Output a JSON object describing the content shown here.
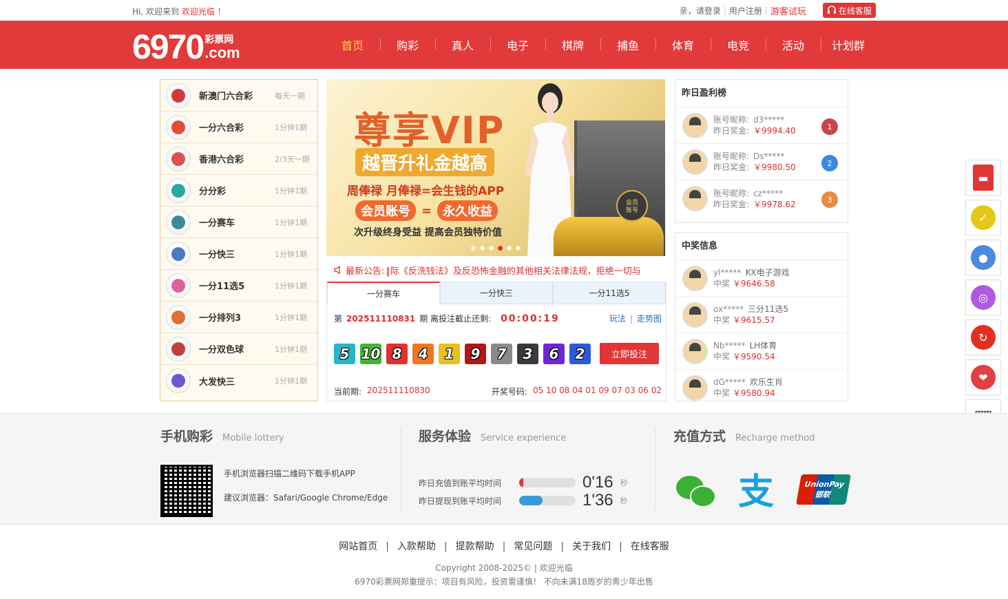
{
  "topbar": {
    "greeting": "Hi, 欢迎来到",
    "site": "欢迎光临",
    "exclaim": "！",
    "login": "亲，请登录",
    "register": "用户注册",
    "trial": "游客试玩",
    "service": "在线客服"
  },
  "logo": {
    "number": "6970",
    "cn": "彩票网",
    "com": ".com"
  },
  "nav": [
    "首页",
    "购彩",
    "真人",
    "电子",
    "棋牌",
    "捕鱼",
    "体育",
    "电竞",
    "活动",
    "计划群"
  ],
  "lotteries": [
    {
      "name": "新澳门六合彩",
      "freq": "每天一期",
      "color": "#d23a3a"
    },
    {
      "name": "一分六合彩",
      "freq": "1分钟1期",
      "color": "#e24a3a"
    },
    {
      "name": "香港六合彩",
      "freq": "2/3天一期",
      "color": "#e05050"
    },
    {
      "name": "分分彩",
      "freq": "1分钟1期",
      "color": "#2aa7a0"
    },
    {
      "name": "一分赛车",
      "freq": "1分钟1期",
      "color": "#3a8a9a"
    },
    {
      "name": "一分快三",
      "freq": "1分钟1期",
      "color": "#4a7ac0"
    },
    {
      "name": "一分11选5",
      "freq": "1分钟1期",
      "color": "#e060a0"
    },
    {
      "name": "一分排列3",
      "freq": "1分钟1期",
      "color": "#e07030"
    },
    {
      "name": "一分双色球",
      "freq": "1分钟1期",
      "color": "#c04040"
    },
    {
      "name": "大发快三",
      "freq": "1分钟1期",
      "color": "#6a5ad0"
    }
  ],
  "banner": {
    "title": "尊享VIP",
    "subtitle": "越晋升礼金越高",
    "line3": "周俸禄 月俸禄=会生钱的APP",
    "pill1": "会员账号",
    "eq": "=",
    "pill2": "永久收益",
    "line5": "次升级终身受益 提高会员独特价值",
    "badge": "会员账号"
  },
  "notice": {
    "label": "最新公告:",
    "text": "‖际《反洗钱法》及反恐怖金融的其他相关法律法规，拒绝一切与"
  },
  "draw": {
    "tabs": [
      "一分赛车",
      "一分快三",
      "一分11选5"
    ],
    "prefix": "第",
    "issue": "202511110831",
    "suffix": "期 离投注截止还剩:",
    "countdown": "00:00:19",
    "rules": "玩法",
    "sep": "|",
    "trend": "走势图",
    "balls": [
      {
        "n": "5",
        "c": "#29b6c6"
      },
      {
        "n": "10",
        "c": "#41b835"
      },
      {
        "n": "8",
        "c": "#e23030"
      },
      {
        "n": "4",
        "c": "#f07820"
      },
      {
        "n": "1",
        "c": "#e8c020"
      },
      {
        "n": "9",
        "c": "#b01818"
      },
      {
        "n": "7",
        "c": "#8a8a8a"
      },
      {
        "n": "3",
        "c": "#3a3a3a"
      },
      {
        "n": "6",
        "c": "#6a28d8"
      },
      {
        "n": "2",
        "c": "#2a5ad8"
      }
    ],
    "bet": "立即投注",
    "prev_label": "当前期:",
    "prev_issue": "202511110830",
    "result_label": "开奖号码:",
    "result": "05 10 08 04 01 09 07 03 06 02"
  },
  "ranking": {
    "title": "昨日盈利榜",
    "items": [
      {
        "acct_label": "账号昵称:",
        "acct": "d3*****",
        "prize_label": "昨日奖金:",
        "prize": "￥9994.40",
        "rank": "1",
        "color": "#c8464a"
      },
      {
        "acct_label": "账号昵称:",
        "acct": "Ds*****",
        "prize_label": "昨日奖金:",
        "prize": "￥9980.50",
        "rank": "2",
        "color": "#3a8ae0"
      },
      {
        "acct_label": "账号昵称:",
        "acct": "cz*****",
        "prize_label": "昨日奖金:",
        "prize": "￥9978.62",
        "rank": "3",
        "color": "#e88a40"
      }
    ]
  },
  "winners": {
    "title": "中奖信息",
    "items": [
      {
        "user": "yl*****",
        "game": "KX电子游戏",
        "label": "中奖",
        "amount": "￥9646.58"
      },
      {
        "user": "ox*****",
        "game": "三分11选5",
        "label": "中奖",
        "amount": "￥9615.57"
      },
      {
        "user": "Nb*****",
        "game": "LH体育",
        "label": "中奖",
        "amount": "￥9590.54"
      },
      {
        "user": "dG*****",
        "game": "欢乐生肖",
        "label": "中奖",
        "amount": "￥9580.94"
      }
    ]
  },
  "side": [
    {
      "name": "red-envelope-icon",
      "color": "#e23535"
    },
    {
      "name": "checkin-icon",
      "color": "#e6c81a"
    },
    {
      "name": "group-icon",
      "color": "#4a8ae0"
    },
    {
      "name": "headset-icon",
      "color": "#b05ae0"
    },
    {
      "name": "recharge-icon",
      "color": "#e23020"
    },
    {
      "name": "gift-hands-icon",
      "color": "#e04040"
    },
    {
      "name": "qr-scan-icon",
      "color": "#666666"
    }
  ],
  "mobile": {
    "title": "手机购彩",
    "en": "Mobile lottery",
    "line1": "手机浏览器扫描二维码下载手机APP",
    "line2": "建议浏览器：Safari/Google Chrome/Edge"
  },
  "service": {
    "title": "服务体验",
    "en": "Service experience",
    "rows": [
      {
        "label": "昨日充值到账平均时间",
        "time": "0'16",
        "unit": "秒",
        "fill": 0.06,
        "color": "#e23535"
      },
      {
        "label": "昨日提现到账平均时间",
        "time": "1'36",
        "unit": "秒",
        "fill": 0.42,
        "color": "#3a9ad8"
      }
    ]
  },
  "recharge": {
    "title": "充值方式",
    "en": "Recharge method",
    "alipay": "支",
    "union1": "UnionPay",
    "union2": "银联"
  },
  "footer": {
    "links": [
      "网站首页",
      "入款帮助",
      "提款帮助",
      "常见问题",
      "关于我们",
      "在线客服"
    ],
    "copyright": "Copyright 2008-2025© | 欢迎光临",
    "warning": "6970彩票网郑重提示：项目有风险，投资需谨慎！ 不向未满18周岁的青少年出售"
  }
}
